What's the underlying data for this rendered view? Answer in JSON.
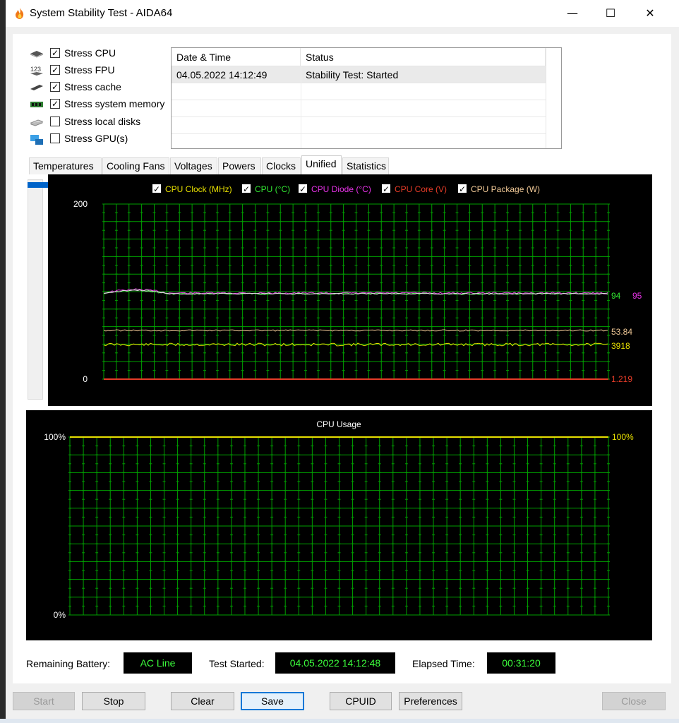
{
  "window": {
    "title": "System Stability Test - AIDA64",
    "minimize": "—",
    "maximize": "☐",
    "close": "✕"
  },
  "stress": [
    {
      "label": "Stress CPU",
      "checked": true,
      "icon": "cpu-chip-icon"
    },
    {
      "label": "Stress FPU",
      "checked": true,
      "icon": "fpu-123-icon"
    },
    {
      "label": "Stress cache",
      "checked": true,
      "icon": "cache-chip-icon"
    },
    {
      "label": "Stress system memory",
      "checked": true,
      "icon": "memory-module-icon"
    },
    {
      "label": "Stress local disks",
      "checked": false,
      "icon": "disk-drive-icon"
    },
    {
      "label": "Stress GPU(s)",
      "checked": false,
      "icon": "gpu-monitor-icon"
    }
  ],
  "log": {
    "headers": [
      "Date & Time",
      "Status"
    ],
    "rows": [
      {
        "time": "04.05.2022 14:12:49",
        "status": "Stability Test: Started"
      }
    ]
  },
  "tabs": [
    "Temperatures",
    "Cooling Fans",
    "Voltages",
    "Powers",
    "Clocks",
    "Unified",
    "Statistics"
  ],
  "active_tab": "Unified",
  "legend": [
    {
      "label": "CPU Clock (MHz)",
      "color": "#e8e000"
    },
    {
      "label": "CPU (°C)",
      "color": "#32e632"
    },
    {
      "label": "CPU Diode (°C)",
      "color": "#e632e6"
    },
    {
      "label": "CPU Core (V)",
      "color": "#e63c28"
    },
    {
      "label": "CPU Package (W)",
      "color": "#f0c896"
    }
  ],
  "upper_graph": {
    "y_top": "200",
    "y_bottom": "0",
    "values": {
      "cpu_temp": "94",
      "diode_temp": "95",
      "package_w": "53.84",
      "clock_mhz": "3918",
      "core_v": "1.219"
    }
  },
  "lower_graph": {
    "title": "CPU Usage",
    "y_top": "100%",
    "y_bottom": "0%",
    "value": "100%"
  },
  "status": {
    "battery_label": "Remaining Battery:",
    "battery_value": "AC Line",
    "started_label": "Test Started:",
    "started_value": "04.05.2022 14:12:48",
    "elapsed_label": "Elapsed Time:",
    "elapsed_value": "00:31:20"
  },
  "buttons": {
    "start": "Start",
    "stop": "Stop",
    "clear": "Clear",
    "save": "Save",
    "cpuid": "CPUID",
    "preferences": "Preferences",
    "close": "Close"
  },
  "colors": {
    "grid": "#00a000",
    "accent": "#0078d7",
    "status_text": "#3cff3c"
  }
}
